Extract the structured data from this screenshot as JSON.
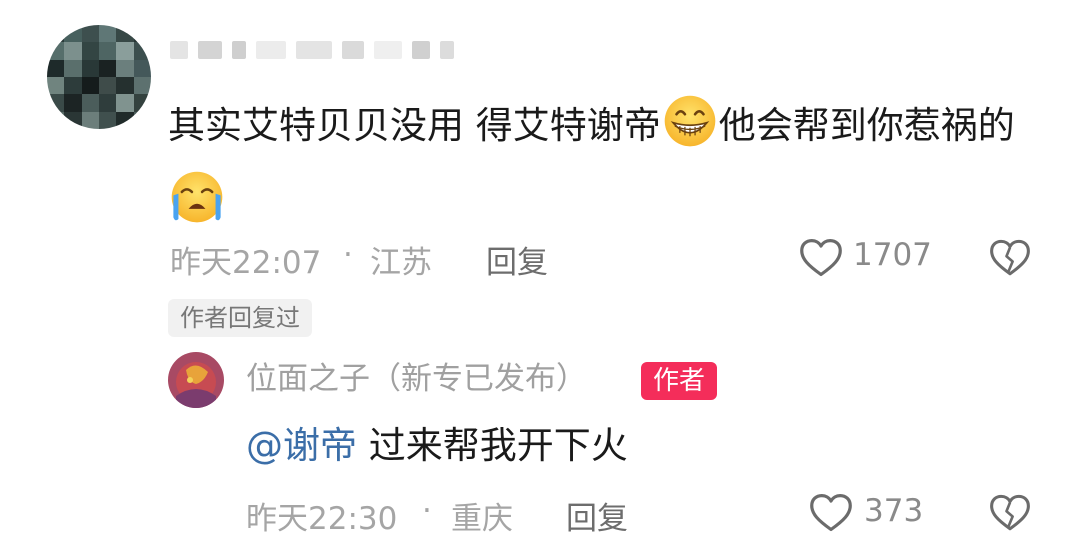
{
  "comment": {
    "text_part1": "其实艾特贝贝没用 得艾特谢帝",
    "text_part2": "他会帮到你惹祸的",
    "emoji1": "grinning-face-emoji",
    "emoji2": "loudly-crying-face-emoji",
    "time": "昨天22:07",
    "separator": "·",
    "location": "江苏",
    "reply_label": "回复",
    "like_count": "1707",
    "author_replied_badge": "作者回复过"
  },
  "reply": {
    "username": "位面之子（新专已发布）",
    "author_tag": "作者",
    "mention": "@谢帝",
    "text": " 过来帮我开下火",
    "time": "昨天22:30",
    "separator": "·",
    "location": "重庆",
    "reply_label": "回复",
    "like_count": "373"
  },
  "icons": {
    "like": "heart-outline-icon",
    "dislike": "broken-heart-icon"
  },
  "colors": {
    "author_tag": "#f42d5a",
    "mention": "#3b6ea8",
    "meta_text": "#a5a5a5"
  }
}
